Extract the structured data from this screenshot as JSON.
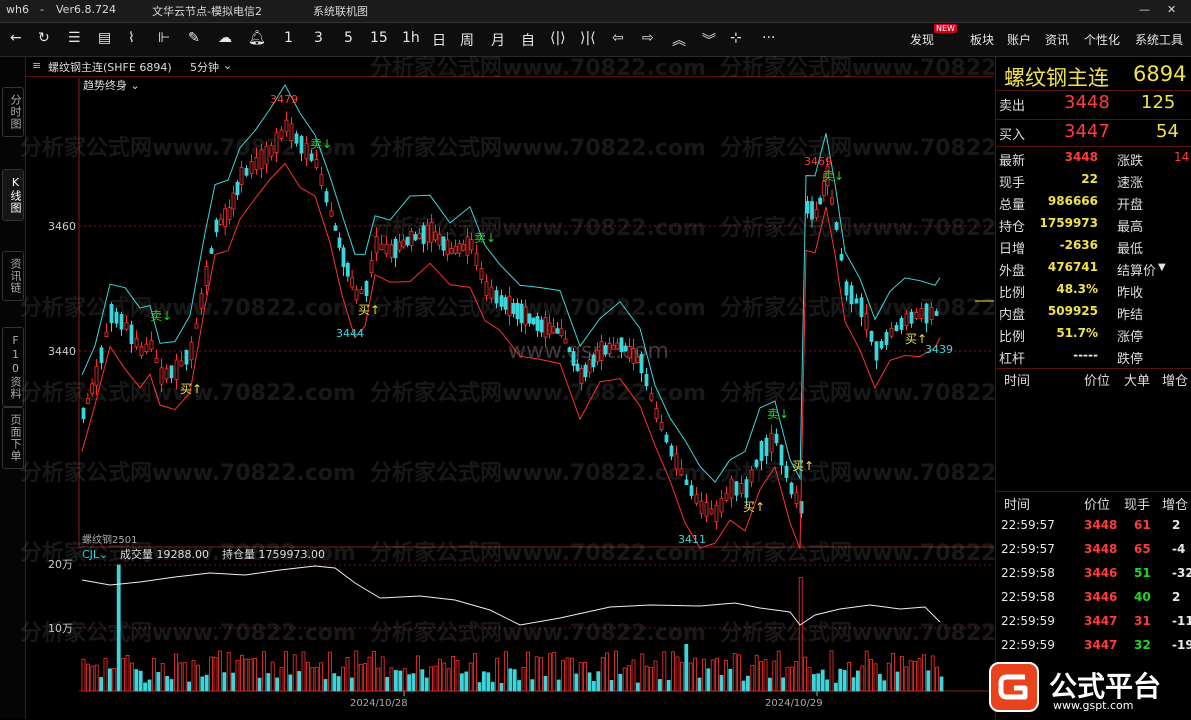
{
  "window": {
    "app": "wh6",
    "version": "Ver6.8.724",
    "account": "文华云节点-模拟电信2",
    "status": "系统联机图"
  },
  "toolbar": {
    "periods": [
      "1",
      "3",
      "5",
      "15",
      "1h",
      "日",
      "周",
      "月",
      "自"
    ],
    "menus": [
      {
        "label": "发现",
        "badge": "NEW"
      },
      {
        "label": "板块"
      },
      {
        "label": "账户"
      },
      {
        "label": "资讯"
      },
      {
        "label": "个性化"
      },
      {
        "label": "系统工具"
      }
    ]
  },
  "left_tabs": [
    "分时图",
    "K线图",
    "资讯链",
    "F10资料",
    "页面下单"
  ],
  "chart_header": {
    "contract": "螺纹钢主连(SHFE 6894)",
    "period": "5分钟",
    "indicator": "趋势终身"
  },
  "volume_header": {
    "name": "CJL",
    "volume_label": "成交量",
    "volume_value": "19288.00",
    "oi_label": "持仓量",
    "oi_value": "1759973.00",
    "contract_note": "螺纹钢2501"
  },
  "quote": {
    "name": "螺纹钢主连",
    "code": "6894",
    "ask_label": "卖出",
    "ask_price": "3448",
    "ask_vol": "125",
    "bid_label": "买入",
    "bid_price": "3447",
    "bid_vol": "54",
    "stats": [
      {
        "label": "最新",
        "value": "3448",
        "label2": "涨跌",
        "value2": "14",
        "color": "red"
      },
      {
        "label": "现手",
        "value": "22",
        "label2": "速涨",
        "value2": "",
        "color": "yellow"
      },
      {
        "label": "总量",
        "value": "986666",
        "label2": "开盘",
        "value2": "",
        "color": "yellow"
      },
      {
        "label": "持仓",
        "value": "1759973",
        "label2": "最高",
        "value2": "",
        "color": "yellow"
      },
      {
        "label": "日增",
        "value": "-2636",
        "label2": "最低",
        "value2": "",
        "color": "yellow"
      },
      {
        "label": "外盘",
        "value": "476741",
        "label2": "结算价",
        "value2": "",
        "color": "yellow"
      },
      {
        "label": "比例",
        "value": "48.3%",
        "label2": "昨收",
        "value2": "",
        "color": "yellow"
      },
      {
        "label": "内盘",
        "value": "509925",
        "label2": "昨结",
        "value2": "",
        "color": "yellow"
      },
      {
        "label": "比例",
        "value": "51.7%",
        "label2": "涨停",
        "value2": "",
        "color": "yellow"
      },
      {
        "label": "杠杆",
        "value": "-----",
        "label2": "跌停",
        "value2": "",
        "color": "white"
      }
    ],
    "bigorder_headers": [
      "时间",
      "价位",
      "大单",
      "增仓"
    ],
    "ticks_headers": [
      "时间",
      "价位",
      "现手",
      "增仓"
    ],
    "ticks": [
      {
        "time": "22:59:57",
        "price": "3448",
        "vol": "61",
        "chg": "2"
      },
      {
        "time": "22:59:57",
        "price": "3448",
        "vol": "65",
        "chg": "-4"
      },
      {
        "time": "22:59:58",
        "price": "3446",
        "vol": "51",
        "chg": "-32"
      },
      {
        "time": "22:59:58",
        "price": "3446",
        "vol": "40",
        "chg": "2"
      },
      {
        "time": "22:59:59",
        "price": "3447",
        "vol": "31",
        "chg": "-11"
      },
      {
        "time": "22:59:59",
        "price": "3447",
        "vol": "32",
        "chg": "-19"
      }
    ]
  },
  "chart_data": {
    "type": "candlestick",
    "y_ticks": [
      "3460",
      "3440"
    ],
    "vol_ticks": [
      "20万",
      "10万"
    ],
    "x_labels": [
      "2024/10/28",
      "2024/10/29"
    ],
    "annotations": [
      {
        "text": "3479",
        "kind": "high"
      },
      {
        "text": "3444",
        "kind": "low"
      },
      {
        "text": "3411",
        "kind": "low"
      },
      {
        "text": "3469",
        "kind": "high"
      },
      {
        "text": "3439",
        "kind": "low"
      }
    ],
    "signals": {
      "sell": "卖",
      "buy": "买"
    }
  },
  "watermarks": [
    "分析家公式网www.70822.com",
    "www.gspt.com"
  ],
  "brand": {
    "name": "公式平台",
    "url": "www.gspt.com"
  }
}
